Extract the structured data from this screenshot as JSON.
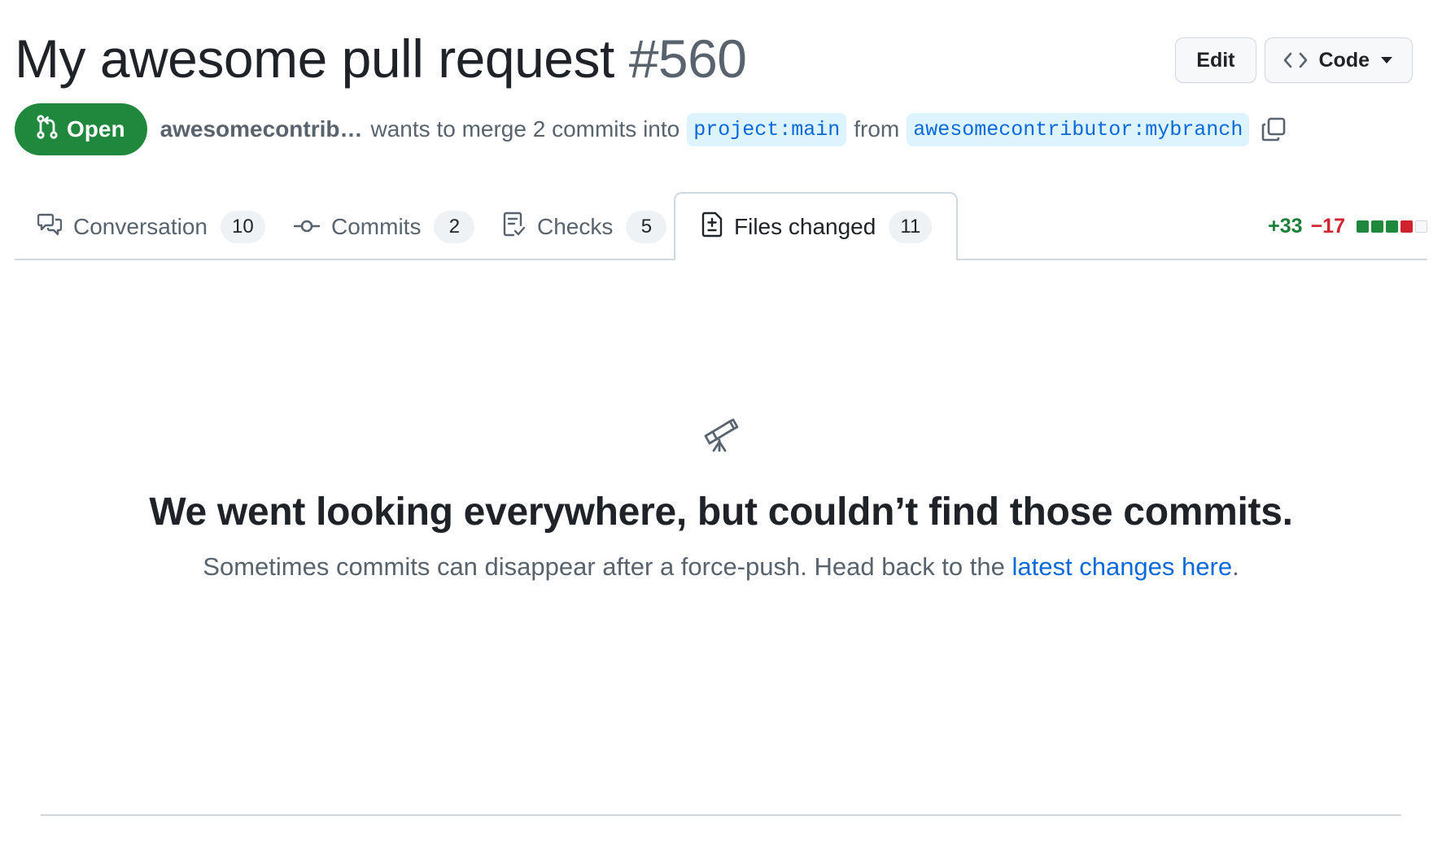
{
  "header": {
    "title": "My awesome pull request",
    "number": "#560",
    "edit_label": "Edit",
    "code_label": "Code"
  },
  "meta": {
    "state": "Open",
    "author": "awesomecontrib…",
    "text_merge": "wants to merge 2 commits into",
    "base_branch": "project:main",
    "text_from": "from",
    "head_branch": "awesomecontributor:mybranch"
  },
  "tabs": [
    {
      "label": "Conversation",
      "count": "10",
      "icon": "comment-discussion-icon"
    },
    {
      "label": "Commits",
      "count": "2",
      "icon": "git-commit-icon"
    },
    {
      "label": "Checks",
      "count": "5",
      "icon": "checklist-icon"
    },
    {
      "label": "Files changed",
      "count": "11",
      "icon": "file-diff-icon",
      "active": true
    }
  ],
  "diffstat": {
    "additions": "+33",
    "deletions": "−17",
    "blocks": [
      "added",
      "added",
      "added",
      "deleted",
      "neutral"
    ]
  },
  "empty_state": {
    "icon": "telescope-icon",
    "heading": "We went looking everywhere, but couldn’t find those commits.",
    "message": "Sometimes commits can disappear after a force-push. Head back to the",
    "link_text": "latest changes here",
    "trailing": "."
  },
  "colors": {
    "open_green": "#1f883d",
    "link_blue": "#0969da",
    "branch_bg": "#ddf4ff",
    "add_green": "#1a7f37",
    "del_red": "#d1242f"
  }
}
